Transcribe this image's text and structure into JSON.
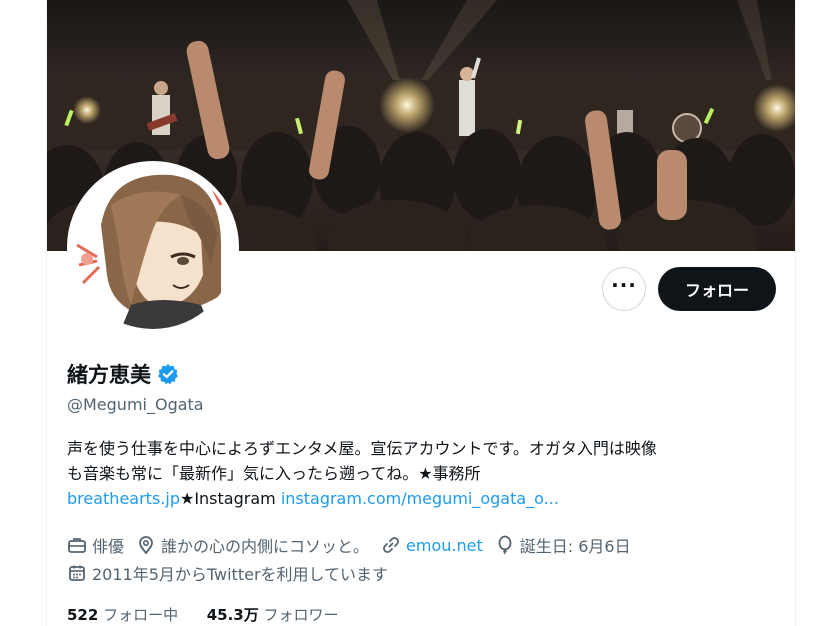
{
  "profile": {
    "display_name": "緒方恵美",
    "handle": "@Megumi_Ogata"
  },
  "actions": {
    "more_label": "···",
    "follow_label": "フォロー"
  },
  "bio": {
    "line1": "声を使う仕事を中心によろずエンタメ屋。宣伝アカウントです。オガタ入門は映像",
    "line2": "も音楽も常に「最新作」気に入ったら遡ってね。★事務所",
    "link1": "breathearts.jp",
    "mid_text": "★Instagram",
    "link2": "instagram.com/megumi_ogata_o..."
  },
  "meta": {
    "category": "俳優",
    "location": "誰かの心の内側にコソッと。",
    "website": "emou.net",
    "birthday": "誕生日: 6月6日",
    "joined": "2011年5月からTwitterを利用しています"
  },
  "stats": {
    "following_count": "522",
    "following_label": "フォロー中",
    "followers_count": "45.3万",
    "followers_label": "フォロワー"
  },
  "colors": {
    "accent": "#1d9bf0",
    "text": "#0f1419",
    "secondary": "#536471",
    "follow_bg": "#0f1419"
  },
  "icons": [
    "more-icon",
    "verified-badge-icon",
    "briefcase-icon",
    "location-pin-icon",
    "link-icon",
    "balloon-icon",
    "calendar-icon"
  ]
}
